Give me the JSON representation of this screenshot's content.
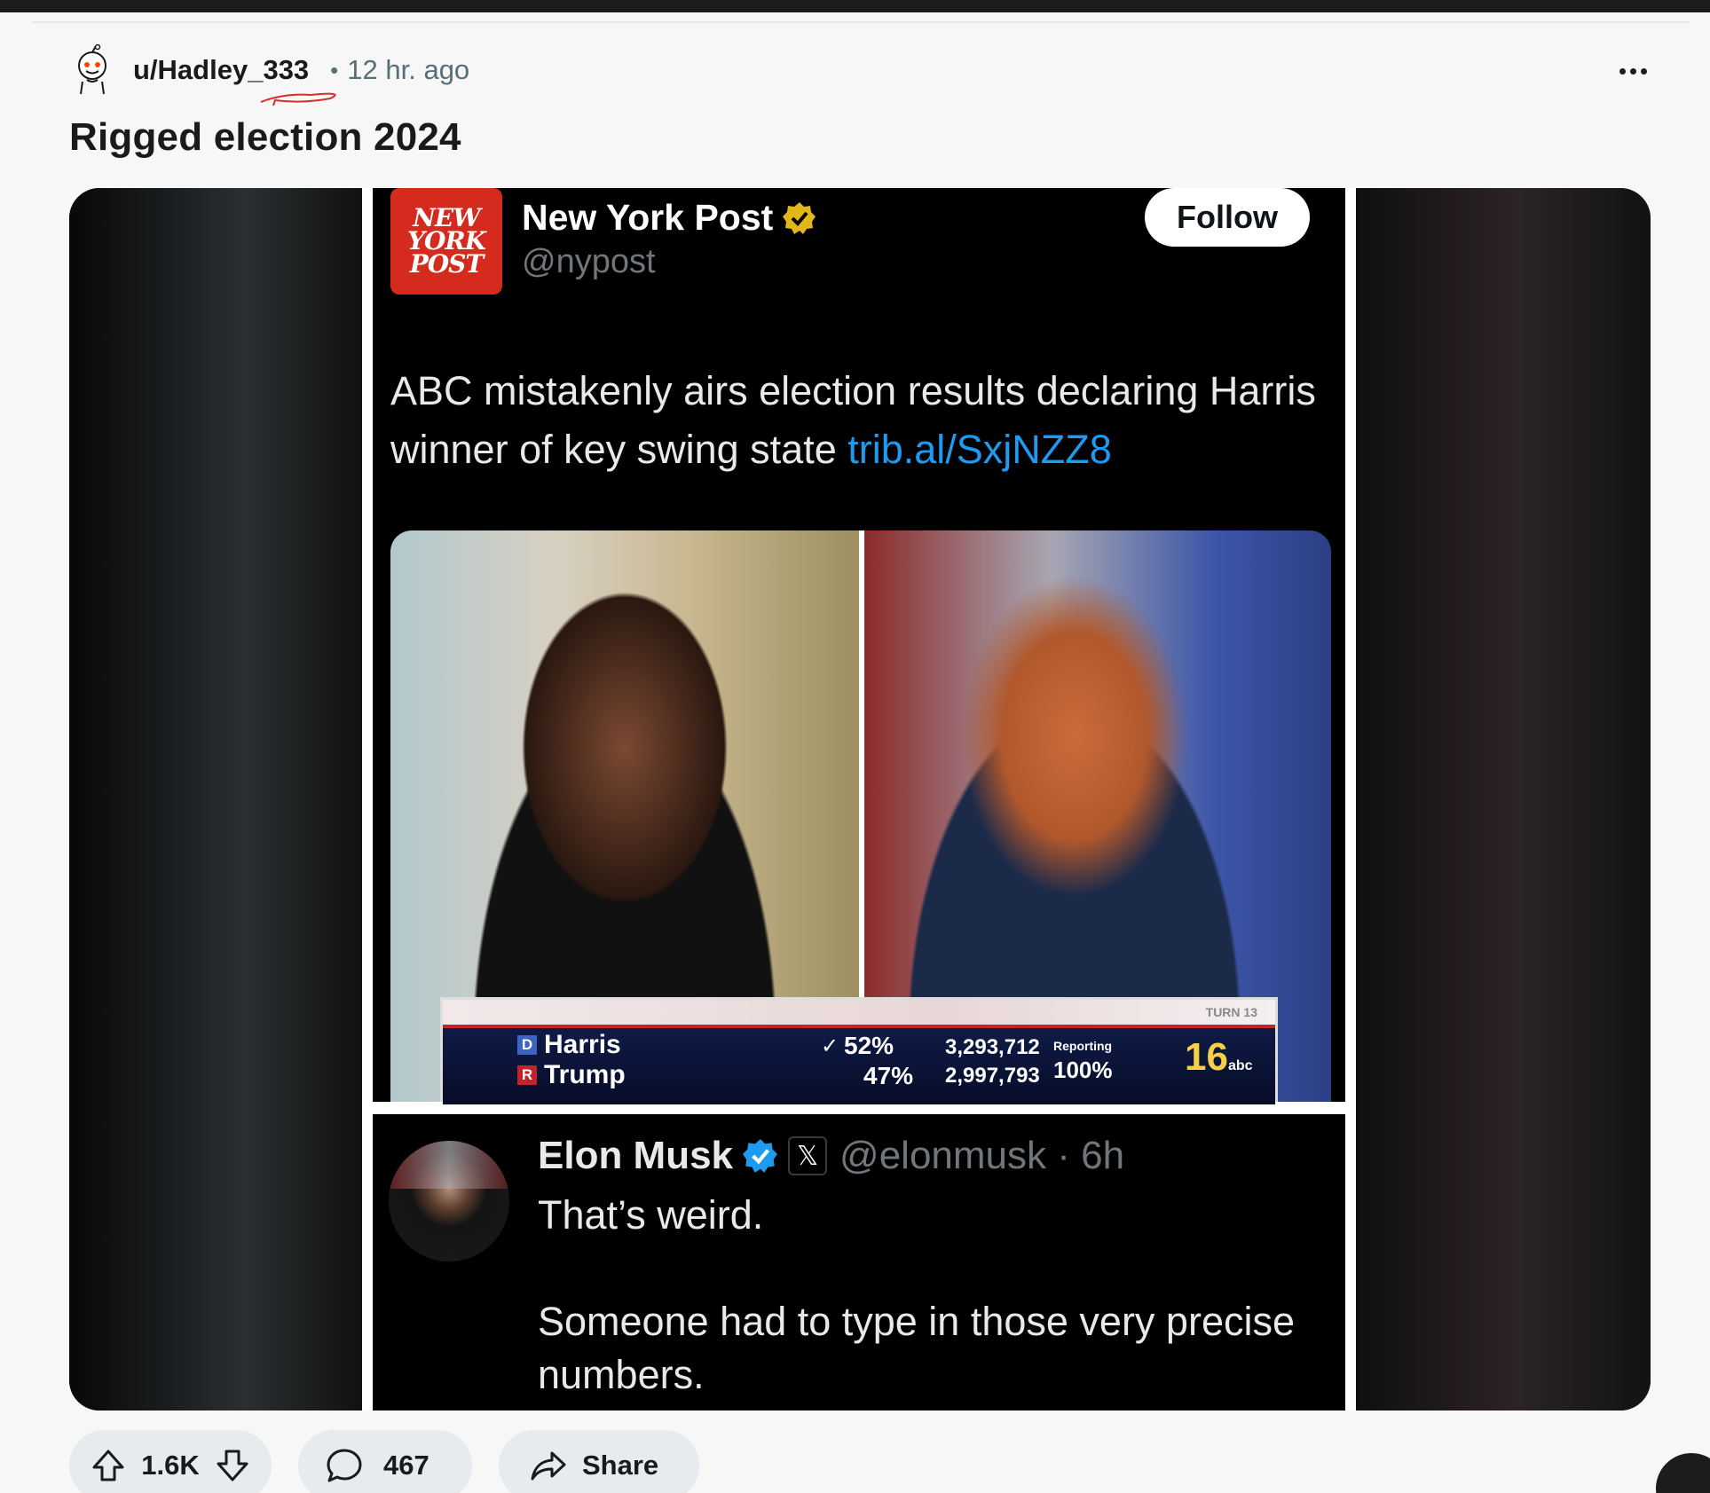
{
  "post": {
    "username": "u/Hadley_333",
    "separator": "•",
    "time": "12 hr. ago",
    "title": "Rigged election 2024"
  },
  "embedded": {
    "nyp_logo_lines": [
      "NEW",
      "YORK",
      "POST"
    ],
    "account_name": "New York Post",
    "account_handle": "@nypost",
    "follow_label": "Follow",
    "tweet_text": "ABC mistakenly airs election results declaring Harris winner of key swing state ",
    "tweet_link": "trib.al/SxjNZZ8",
    "results": {
      "turn_label": "TURN 13",
      "d_party": "D",
      "d_name": "Harris",
      "d_pct": "52%",
      "d_votes": "3,293,712",
      "r_party": "R",
      "r_name": "Trump",
      "r_pct": "47%",
      "r_votes": "2,997,793",
      "reporting_label": "Reporting",
      "reporting_value": "100%",
      "channel_number": "16",
      "channel_name": "abc"
    },
    "reply": {
      "name": "Elon Musk",
      "x_badge": "𝕏",
      "handle": "@elonmusk · 6h",
      "text": "That’s weird.\n\nSomeone had to type in those very precise numbers."
    }
  },
  "actions": {
    "upvotes": "1.6K",
    "comments": "467",
    "share_label": "Share"
  },
  "colors": {
    "page_bg": "#f7f7f7",
    "pill_bg": "#e5ebee",
    "nyp_red": "#d52b1e",
    "link_blue": "#1d9bf0",
    "verified_gold": "#e2b719",
    "verified_blue": "#1d9bf0"
  }
}
